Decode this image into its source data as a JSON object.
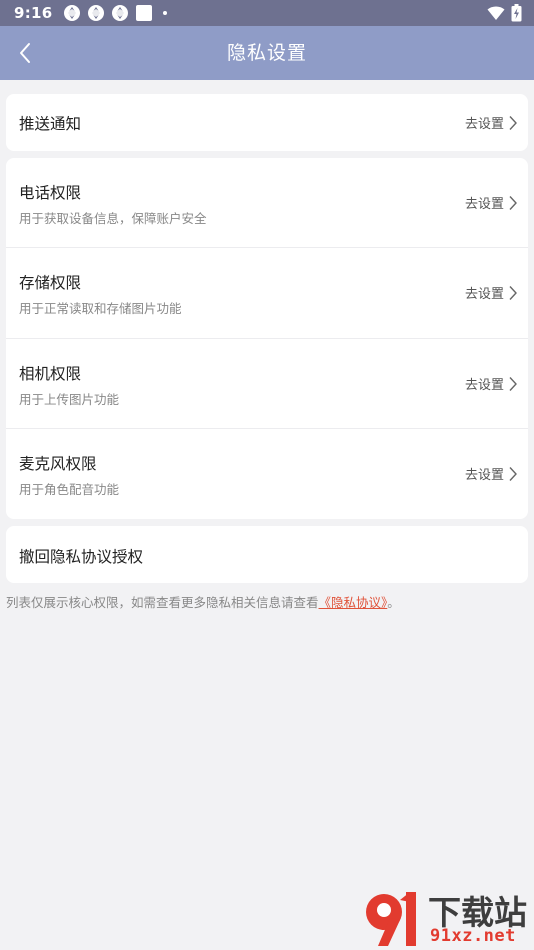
{
  "status_bar": {
    "time": "9:16",
    "icons": [
      "app-notification-icon",
      "app-notification-icon",
      "app-notification-icon",
      "square-notification-icon",
      "dot-icon",
      "wifi-icon",
      "battery-charging-icon"
    ]
  },
  "header": {
    "title": "隐私设置",
    "back_icon": "chevron-left-icon"
  },
  "sections": {
    "push": {
      "title": "推送通知",
      "action": "去设置"
    },
    "permissions": [
      {
        "title": "电话权限",
        "subtitle": "用于获取设备信息，保障账户安全",
        "action": "去设置"
      },
      {
        "title": "存储权限",
        "subtitle": "用于正常读取和存储图片功能",
        "action": "去设置"
      },
      {
        "title": "相机权限",
        "subtitle": "用于上传图片功能",
        "action": "去设置"
      },
      {
        "title": "麦克风权限",
        "subtitle": "用于角色配音功能",
        "action": "去设置"
      }
    ],
    "revoke": {
      "title": "撤回隐私协议授权"
    }
  },
  "footer": {
    "note": "列表仅展示核心权限，如需查看更多隐私相关信息请查看",
    "link": "《隐私协议》",
    "end": "。"
  },
  "watermark": {
    "line1": "下载站",
    "line2": "91xz.net"
  },
  "colors": {
    "status_bar": "#6e7190",
    "header": "#8f9cc7",
    "background": "#f2f2f4",
    "link": "#e0533a"
  }
}
